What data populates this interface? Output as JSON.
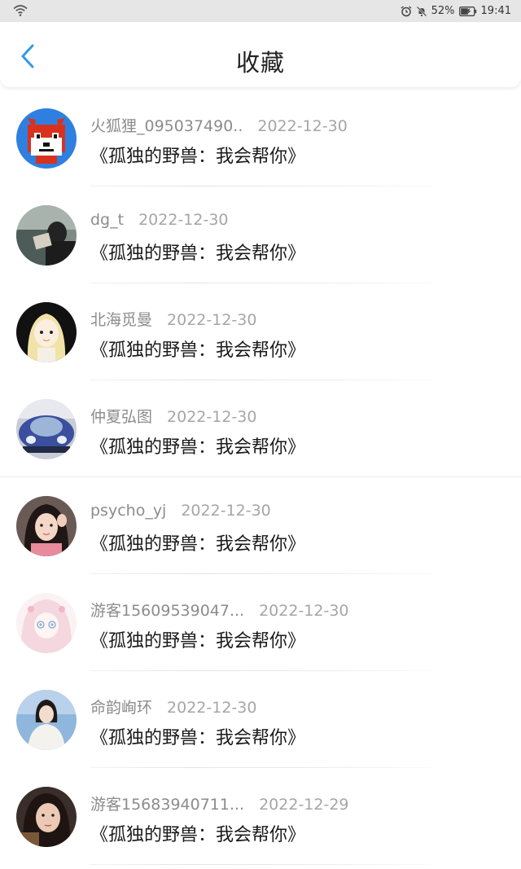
{
  "status_bar": {
    "battery": "52%",
    "time": "19:41"
  },
  "header": {
    "title": "收藏"
  },
  "items": [
    {
      "username": "火狐狸_095037490..",
      "date": "2022-12-30",
      "content": "《孤独的野兽：我会帮你》",
      "avatar": "fox-pixel-avatar"
    },
    {
      "username": "dg_t",
      "date": "2022-12-30",
      "content": "《孤独的野兽：我会帮你》",
      "avatar": "reading-person-avatar"
    },
    {
      "username": "北海觅曼",
      "date": "2022-12-30",
      "content": "《孤独的野兽：我会帮你》",
      "avatar": "anime-girl-avatar"
    },
    {
      "username": "仲夏弘图",
      "date": "2022-12-30",
      "content": "《孤独的野兽：我会帮你》",
      "avatar": "car-avatar"
    },
    {
      "username": "psycho_yj",
      "date": "2022-12-30",
      "content": "《孤独的野兽：我会帮你》",
      "avatar": "girl-photo-avatar"
    },
    {
      "username": "游客15609539047...",
      "date": "2022-12-30",
      "content": "《孤独的野兽：我会帮你》",
      "avatar": "pastel-anime-avatar"
    },
    {
      "username": "命韵峋环",
      "date": "2022-12-30",
      "content": "《孤独的野兽：我会帮你》",
      "avatar": "woman-white-sweater-avatar"
    },
    {
      "username": "游客15683940711...",
      "date": "2022-12-29",
      "content": "《孤独的野兽：我会帮你》",
      "avatar": "woman-portrait-avatar"
    }
  ]
}
